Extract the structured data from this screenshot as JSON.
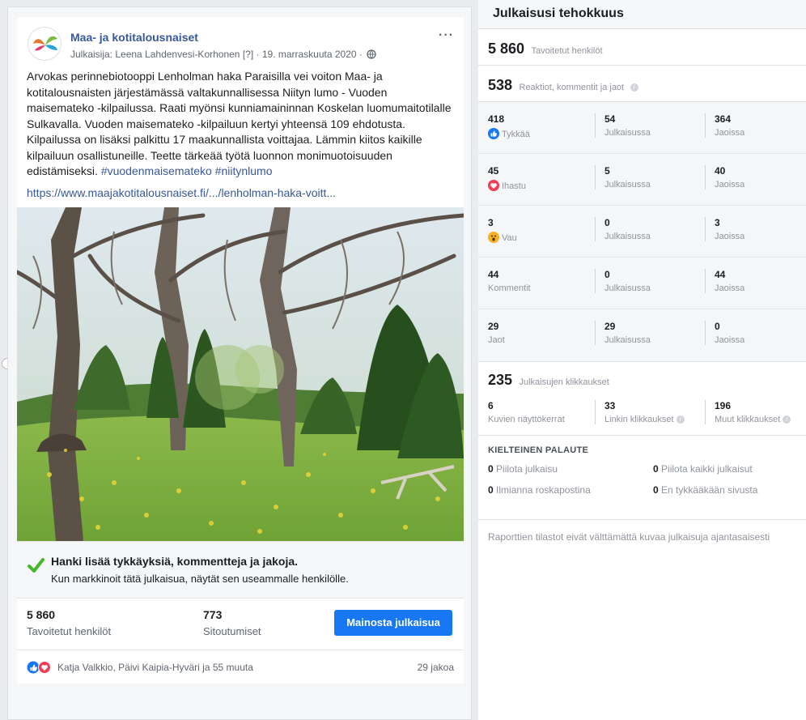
{
  "post": {
    "page_name": "Maa- ja kotitalousnaiset",
    "meta": "Julkaisija: Leena Lahdenvesi-Korhonen [?] · 19. marraskuuta 2020 ·",
    "more": "···",
    "text_p1": "Arvokas perinnebiotooppi Lenholman haka Paraisilla vei voiton Maa- ja kotitalousnaisten järjestämässä valtakunnallisessa Niityn lumo - Vuoden maisemateko -kilpailussa. Raati myönsi kunniamaininnan Koskelan luomumaitotilalle Sulkavalla. Vuoden maisemateko -kilpailuun kertyi yhteensä 109 ehdotusta.",
    "text_p2": "Kilpailussa on lisäksi palkittu 17 maakunnallista voittajaa. Lämmin kiitos kaikille kilpailuun osallistuneille. Teette tärkeää työtä luonnon monimuotoisuuden edistämiseksi.",
    "hashtags": "#vuodenmaisemateko #niitynlumo",
    "link": "https://www.maajakotitalousnaiset.fi/.../lenholman-haka-voitt..."
  },
  "promo": {
    "title": "Hanki lisää tykkäyksiä, kommentteja ja jakoja.",
    "subtitle": "Kun markkinoit tätä julkaisua, näytät sen useammalle henkilölle."
  },
  "post_stats": {
    "reach_value": "5 860",
    "reach_label": "Tavoitetut henkilöt",
    "engagement_value": "773",
    "engagement_label": "Sitoutumiset",
    "boost_label": "Mainosta julkaisua"
  },
  "reactions_bar": {
    "names": "Katja Valkkio, Päivi Kaipia-Hyväri ja 55 muuta",
    "shares": "29 jakoa"
  },
  "insights": {
    "title": "Julkaisusi tehokkuus",
    "reach_value": "5 860",
    "reach_label": "Tavoitetut henkilöt",
    "reactions_value": "538",
    "reactions_label": "Reaktiot, kommentit ja jaot",
    "rows": [
      {
        "icon": "like-icon",
        "total": "418",
        "label": "Tykkää",
        "on_post": "54",
        "on_post_label": "Julkaisussa",
        "on_shares": "364",
        "on_shares_label": "Jaoissa"
      },
      {
        "icon": "love-icon",
        "total": "45",
        "label": "Ihastu",
        "on_post": "5",
        "on_post_label": "Julkaisussa",
        "on_shares": "40",
        "on_shares_label": "Jaoissa"
      },
      {
        "icon": "wow-icon",
        "total": "3",
        "label": "Vau",
        "on_post": "0",
        "on_post_label": "Julkaisussa",
        "on_shares": "3",
        "on_shares_label": "Jaoissa"
      },
      {
        "icon": "",
        "total": "44",
        "label": "Kommentit",
        "on_post": "0",
        "on_post_label": "Julkaisussa",
        "on_shares": "44",
        "on_shares_label": "Jaoissa"
      },
      {
        "icon": "",
        "total": "29",
        "label": "Jaot",
        "on_post": "29",
        "on_post_label": "Julkaisussa",
        "on_shares": "0",
        "on_shares_label": "Jaoissa"
      }
    ],
    "clicks_value": "235",
    "clicks_label": "Julkaisujen klikkaukset",
    "photo_views": "6",
    "photo_views_label": "Kuvien näyttökerrat",
    "link_clicks": "33",
    "link_clicks_label": "Linkin klikkaukset",
    "other_clicks": "196",
    "other_clicks_label": "Muut klikkaukset",
    "negative_title": "KIELTEINEN PALAUTE",
    "hide_post_value": "0",
    "hide_post_label": "Piilota julkaisu",
    "hide_all_value": "0",
    "hide_all_label": "Piilota kaikki julkaisut",
    "report_spam_value": "0",
    "report_spam_label": "Ilmianna roskapostina",
    "unlike_value": "0",
    "unlike_label": "En tykkääkään sivusta",
    "footnote": "Raporttien tilastot eivät välttämättä kuvaa julkaisuja ajantasaisesti"
  },
  "colors": {
    "brand_blue": "#1877f2",
    "link_blue": "#385898",
    "love_red": "#f33e58",
    "wow_yellow": "#f7b125",
    "check_green": "#42b72a"
  }
}
